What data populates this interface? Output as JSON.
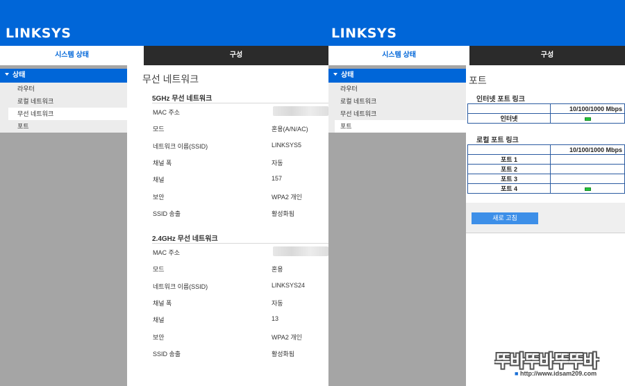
{
  "left": {
    "logo": "LINKSYS",
    "tabs": {
      "status": "시스템 상태",
      "config": "구성"
    },
    "sidebar": {
      "header": "상태",
      "items": [
        "라우터",
        "로컬 네트워크",
        "무선 네트워크",
        "포트"
      ]
    },
    "page_title": "무선 네트워크",
    "wifi5": {
      "title": "5GHz 무선 네트워크",
      "rows": [
        {
          "label": "MAC 주소",
          "value": ""
        },
        {
          "label": "모드",
          "value": "혼용(A/N/AC)"
        },
        {
          "label": "네트워크 이름(SSID)",
          "value": "LINKSYS5"
        },
        {
          "label": "채널 폭",
          "value": "자동"
        },
        {
          "label": "채널",
          "value": "157"
        },
        {
          "label": "보안",
          "value": "WPA2 개인"
        },
        {
          "label": "SSID 송출",
          "value": "활성화됨"
        }
      ]
    },
    "wifi24": {
      "title": "2.4GHz 무선 네트워크",
      "rows": [
        {
          "label": "MAC 주소",
          "value": ""
        },
        {
          "label": "모드",
          "value": "혼용"
        },
        {
          "label": "네트워크 이름(SSID)",
          "value": "LINKSYS24"
        },
        {
          "label": "채널 폭",
          "value": "자동"
        },
        {
          "label": "채널",
          "value": "13"
        },
        {
          "label": "보안",
          "value": "WPA2 개인"
        },
        {
          "label": "SSID 송출",
          "value": "활성화됨"
        }
      ]
    }
  },
  "right": {
    "logo": "LINKSYS",
    "tabs": {
      "status": "시스템 상태",
      "config": "구성"
    },
    "sidebar": {
      "header": "상태",
      "items": [
        "라우터",
        "로컬 네트워크",
        "무선 네트워크",
        "포트"
      ]
    },
    "page_title": "포트",
    "internet": {
      "title": "인터넷 포트 링크",
      "speed_header": "10/100/1000 Mbps",
      "ports": [
        {
          "name": "인터넷",
          "link": true
        }
      ]
    },
    "local": {
      "title": "로컬 포트 링크",
      "speed_header": "10/100/1000 Mbps",
      "ports": [
        {
          "name": "포트 1",
          "link": false
        },
        {
          "name": "포트 2",
          "link": false
        },
        {
          "name": "포트 3",
          "link": false
        },
        {
          "name": "포트 4",
          "link": true
        }
      ]
    },
    "refresh_label": "새로 고침"
  },
  "watermark": {
    "text": "뚜바뚜바뚜뚜바",
    "url": "http://www.idsam209.com"
  },
  "colors": {
    "brand_blue": "#0066d8",
    "dark_tab": "#2b2b2b",
    "sidebar_gray": "#a5a5a5",
    "led_green": "#24c43a"
  }
}
